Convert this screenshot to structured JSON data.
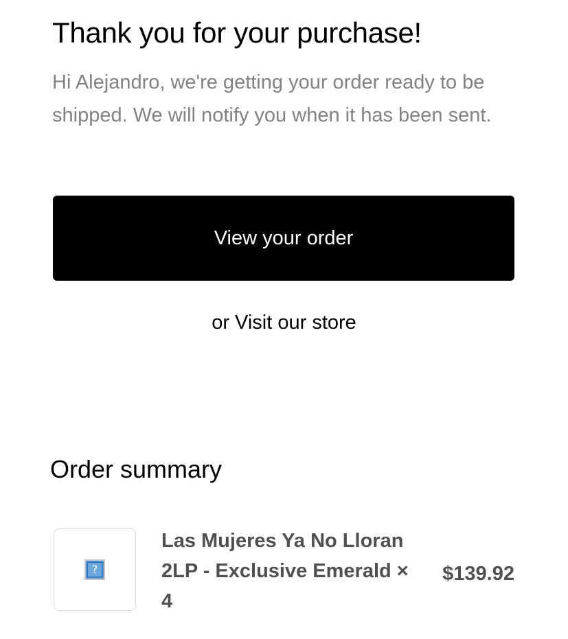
{
  "header": {
    "title": "Thank you for your purchase!",
    "message": "Hi Alejandro, we're getting your order ready to be shipped. We will notify you when it has been sent."
  },
  "actions": {
    "view_order_label": "View your order",
    "or_text": "or",
    "visit_store_label": "Visit our store"
  },
  "order_summary": {
    "heading": "Order summary",
    "items": [
      {
        "title": "Las Mujeres Ya No Lloran 2LP - Exclusive Emerald × 4",
        "price": "$139.92",
        "image_icon": "broken-image-icon",
        "image_placeholder": "?"
      }
    ]
  },
  "colors": {
    "text_primary": "#000000",
    "text_secondary": "#828282",
    "text_item": "#505050",
    "button_bg": "#000000",
    "button_text": "#ffffff"
  }
}
